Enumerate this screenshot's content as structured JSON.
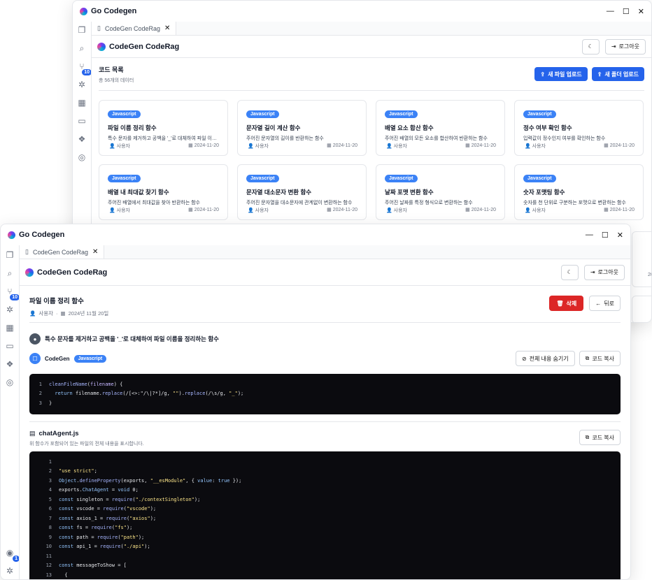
{
  "back": {
    "app_name": "Go Codegen",
    "tab_label": "CodeGen CodeRag",
    "header_title": "CodeGen CodeRag",
    "logout_label": "로그아웃",
    "list_title": "코드 목록",
    "list_count": "총 56개의 데이터",
    "upload_file_label": "새 파일 업로드",
    "upload_folder_label": "새 폴더 업로드",
    "sidebar_badge": "10",
    "cards": [
      {
        "lang": "Javascript",
        "title": "파일 이름 정리 함수",
        "desc": "특수 문자를 제거하고 공백을 '_'로 대체하여 파일 이름...",
        "user": "사용자",
        "date": "2024-11-20"
      },
      {
        "lang": "Javascript",
        "title": "문자열 길이 계산 함수",
        "desc": "주어진 문자열의 길이를 반환하는 함수",
        "user": "사용자",
        "date": "2024-11-20"
      },
      {
        "lang": "Javascript",
        "title": "배열 요소 합산 함수",
        "desc": "주어진 배열의 모든 요소를 합산하여 반환하는 함수",
        "user": "사용자",
        "date": "2024-11-20"
      },
      {
        "lang": "Javascript",
        "title": "정수 여부 확인 함수",
        "desc": "입력값이 정수인지 여부를 확인하는 함수",
        "user": "사용자",
        "date": "2024-11-20"
      },
      {
        "lang": "Javascript",
        "title": "배열 내 최대값 찾기 함수",
        "desc": "주어진 배열에서 최대값을 찾아 반환하는 함수",
        "user": "사용자",
        "date": "2024-11-20"
      },
      {
        "lang": "Javascript",
        "title": "문자열 대소문자 변환 함수",
        "desc": "주어진 문자열을 대소문자에 관계없이 변환하는 함수",
        "user": "사용자",
        "date": "2024-11-20"
      },
      {
        "lang": "Javascript",
        "title": "날짜 포맷 변환 함수",
        "desc": "주어진 날짜를 특정 형식으로 변환하는 함수",
        "user": "사용자",
        "date": "2024-11-20"
      },
      {
        "lang": "Javascript",
        "title": "숫자 포맷팅 함수",
        "desc": "숫자를 천 단위로 구분하는 포맷으로 변환하는 함수",
        "user": "사용자",
        "date": "2024-11-20"
      }
    ],
    "peek_date": "20"
  },
  "front": {
    "app_name": "Go Codegen",
    "tab_label": "CodeGen CodeRag",
    "header_title": "CodeGen CodeRag",
    "logout_label": "로그아웃",
    "sidebar_badge": "10",
    "sidebar_bottom_badge": "1",
    "detail_title": "파일 이름 정리 함수",
    "author": "사용자",
    "date": "2024년 11월 20일",
    "delete_label": "삭제",
    "back_label": "뒤로",
    "question": "특수 문자를 제거하고 공백을 '_'로 대체하여 파일 이름을 정리하는 함수",
    "bot_name": "CodeGen",
    "lang": "Javascript",
    "hide_label": "전체 내용 숨기기",
    "copy_label": "코드 복사",
    "file_name": "chatAgent.js",
    "file_desc": "위 함수가 포함되어 있는 파일의 전체 내용을 표시합니다.",
    "copy2_label": "코드 복사"
  },
  "snippet_lines": [
    {
      "n": "1",
      "parts": [
        {
          "c": "fn",
          "t": "cleanFileName"
        },
        {
          "c": "",
          "t": "("
        },
        {
          "c": "pm",
          "t": "filename"
        },
        {
          "c": "",
          "t": ") {"
        }
      ]
    },
    {
      "n": "2",
      "parts": [
        {
          "c": "kw",
          "t": "  return "
        },
        {
          "c": "",
          "t": "filename."
        },
        {
          "c": "fn",
          "t": "replace"
        },
        {
          "c": "",
          "t": "(/[<>:\"/\\|?*]/g, "
        },
        {
          "c": "st",
          "t": "\"\""
        },
        {
          "c": "",
          "t": ")."
        },
        {
          "c": "fn",
          "t": "replace"
        },
        {
          "c": "",
          "t": "(/\\s/g, "
        },
        {
          "c": "st",
          "t": "\"_\""
        },
        {
          "c": "",
          "t": ");"
        }
      ]
    },
    {
      "n": "3",
      "parts": [
        {
          "c": "",
          "t": "}"
        }
      ]
    }
  ],
  "file_lines": [
    {
      "n": "1",
      "parts": []
    },
    {
      "n": "2",
      "parts": [
        {
          "c": "st",
          "t": "\"use strict\""
        },
        {
          "c": "",
          "t": ";"
        }
      ]
    },
    {
      "n": "3",
      "parts": [
        {
          "c": "kw",
          "t": "Object"
        },
        {
          "c": "",
          "t": "."
        },
        {
          "c": "fn",
          "t": "defineProperty"
        },
        {
          "c": "",
          "t": "(exports, "
        },
        {
          "c": "st",
          "t": "\"__esModule\""
        },
        {
          "c": "",
          "t": ", { "
        },
        {
          "c": "kw",
          "t": "value"
        },
        {
          "c": "",
          "t": ": "
        },
        {
          "c": "kw",
          "t": "true"
        },
        {
          "c": "",
          "t": " });"
        }
      ]
    },
    {
      "n": "4",
      "parts": [
        {
          "c": "",
          "t": "exports."
        },
        {
          "c": "kw",
          "t": "ChatAgent"
        },
        {
          "c": "",
          "t": " = "
        },
        {
          "c": "kw",
          "t": "void"
        },
        {
          "c": "",
          "t": " 0;"
        }
      ]
    },
    {
      "n": "5",
      "parts": [
        {
          "c": "kw",
          "t": "const"
        },
        {
          "c": "",
          "t": " singleton = "
        },
        {
          "c": "fn",
          "t": "require"
        },
        {
          "c": "",
          "t": "("
        },
        {
          "c": "st",
          "t": "\"./contextSingleton\""
        },
        {
          "c": "",
          "t": ");"
        }
      ]
    },
    {
      "n": "6",
      "parts": [
        {
          "c": "kw",
          "t": "const"
        },
        {
          "c": "",
          "t": " vscode = "
        },
        {
          "c": "fn",
          "t": "require"
        },
        {
          "c": "",
          "t": "("
        },
        {
          "c": "st",
          "t": "\"vscode\""
        },
        {
          "c": "",
          "t": ");"
        }
      ]
    },
    {
      "n": "7",
      "parts": [
        {
          "c": "kw",
          "t": "const"
        },
        {
          "c": "",
          "t": " axios_1 = "
        },
        {
          "c": "fn",
          "t": "require"
        },
        {
          "c": "",
          "t": "("
        },
        {
          "c": "st",
          "t": "\"axios\""
        },
        {
          "c": "",
          "t": ");"
        }
      ]
    },
    {
      "n": "8",
      "parts": [
        {
          "c": "kw",
          "t": "const"
        },
        {
          "c": "",
          "t": " fs = "
        },
        {
          "c": "fn",
          "t": "require"
        },
        {
          "c": "",
          "t": "("
        },
        {
          "c": "st",
          "t": "\"fs\""
        },
        {
          "c": "",
          "t": ");"
        }
      ]
    },
    {
      "n": "9",
      "parts": [
        {
          "c": "kw",
          "t": "const"
        },
        {
          "c": "",
          "t": " path = "
        },
        {
          "c": "fn",
          "t": "require"
        },
        {
          "c": "",
          "t": "("
        },
        {
          "c": "st",
          "t": "\"path\""
        },
        {
          "c": "",
          "t": ");"
        }
      ]
    },
    {
      "n": "10",
      "parts": [
        {
          "c": "kw",
          "t": "const"
        },
        {
          "c": "",
          "t": " api_1 = "
        },
        {
          "c": "fn",
          "t": "require"
        },
        {
          "c": "",
          "t": "("
        },
        {
          "c": "st",
          "t": "\"./api\""
        },
        {
          "c": "",
          "t": ");"
        }
      ]
    },
    {
      "n": "11",
      "parts": []
    },
    {
      "n": "12",
      "parts": [
        {
          "c": "kw",
          "t": "const"
        },
        {
          "c": "",
          "t": " messageToShow = ["
        }
      ]
    },
    {
      "n": "13",
      "parts": [
        {
          "c": "",
          "t": "  {"
        }
      ]
    }
  ]
}
